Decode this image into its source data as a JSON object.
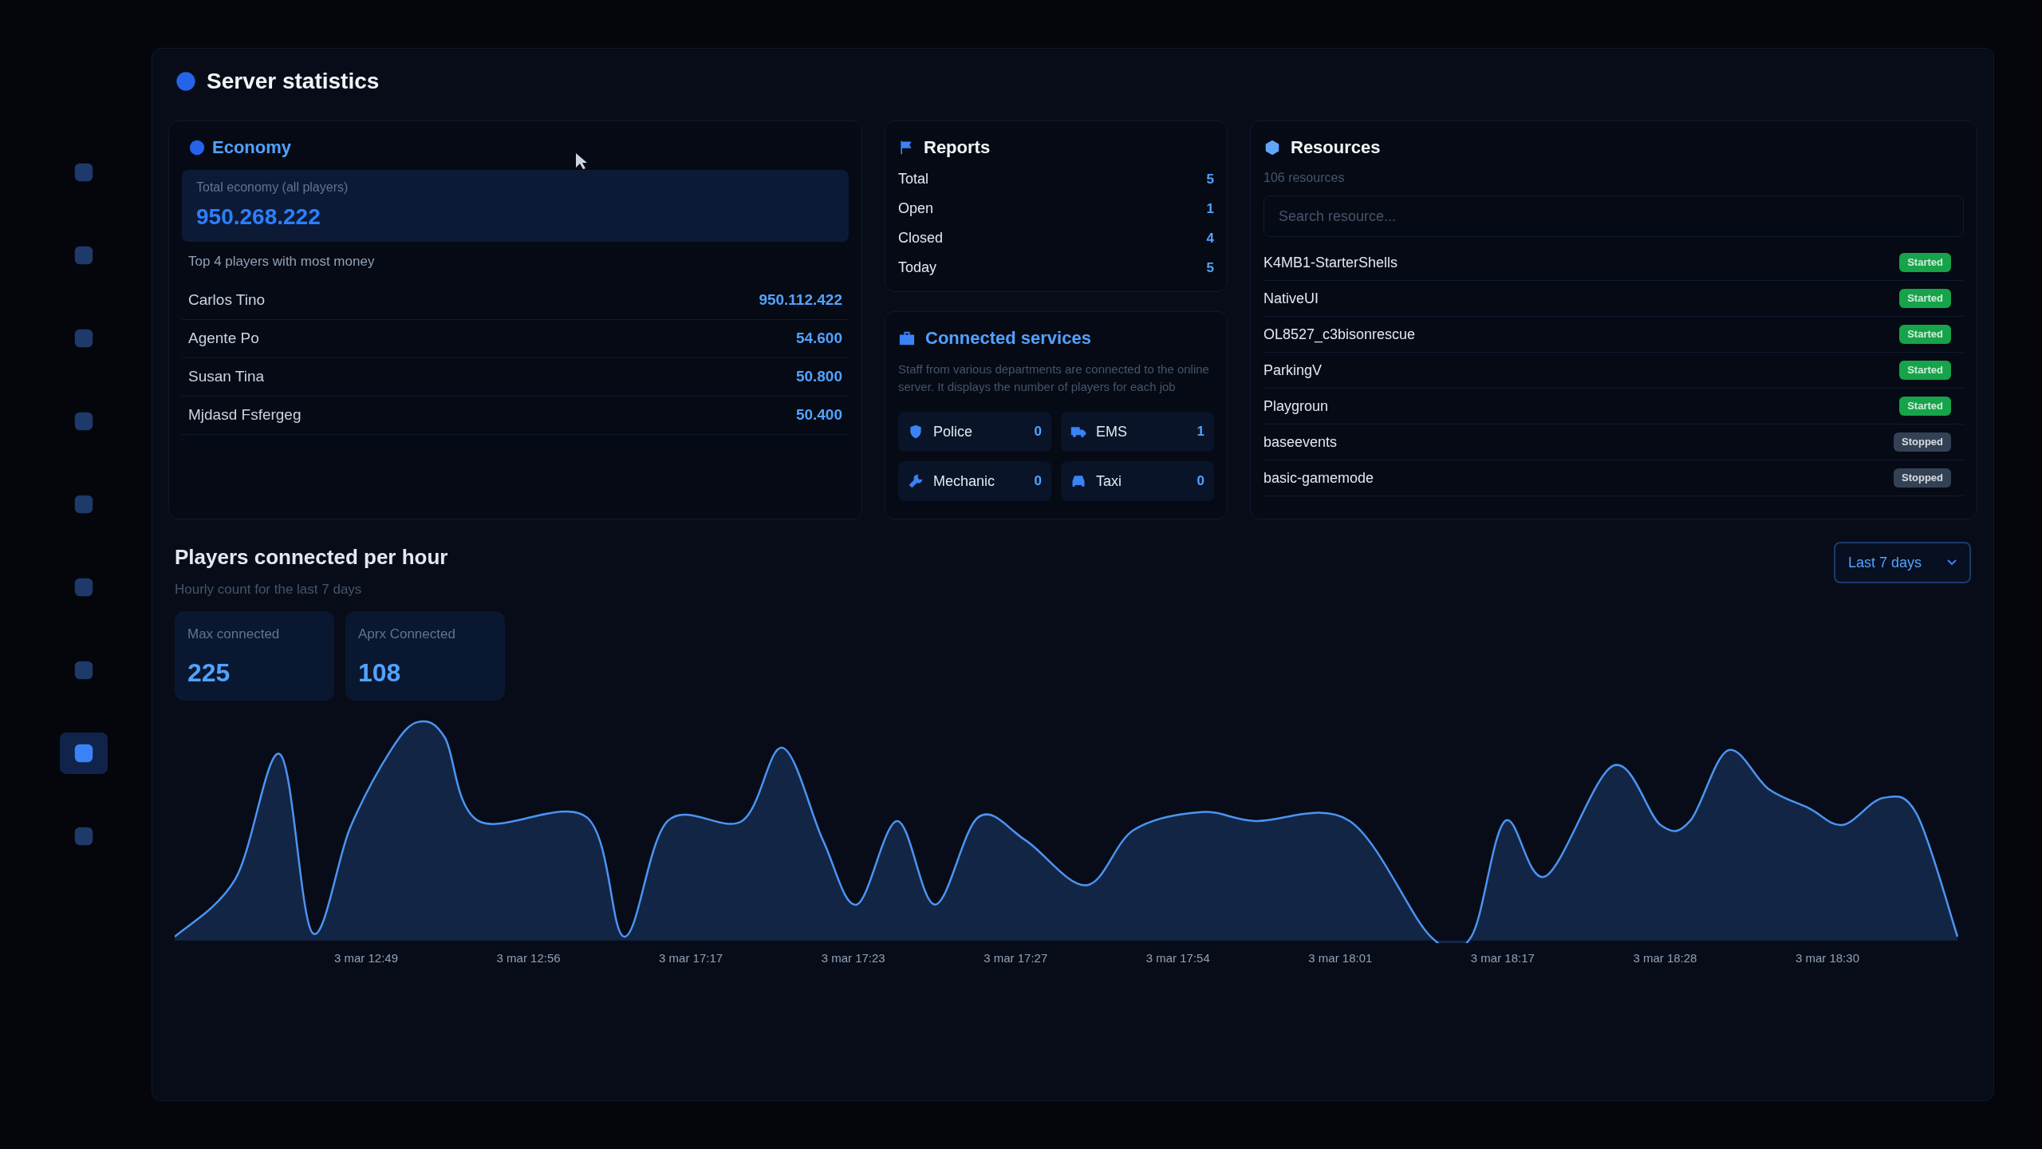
{
  "title": "Server statistics",
  "sidebar": {
    "items": [
      {
        "selected": false
      },
      {
        "selected": false
      },
      {
        "selected": false
      },
      {
        "selected": false
      },
      {
        "selected": false
      },
      {
        "selected": false
      },
      {
        "selected": false
      },
      {
        "selected": true
      },
      {
        "selected": false
      }
    ]
  },
  "economy": {
    "title": "Economy",
    "total_label": "Total economy (all players)",
    "total_value": "950.268.222",
    "top_label": "Top 4 players with most money",
    "players": [
      {
        "name": "Carlos Tino",
        "money": "950.112.422"
      },
      {
        "name": "Agente Po",
        "money": "54.600"
      },
      {
        "name": "Susan Tina",
        "money": "50.800"
      },
      {
        "name": "Mjdasd Fsfergeg",
        "money": "50.400"
      }
    ]
  },
  "reports": {
    "title": "Reports",
    "rows": [
      {
        "label": "Total",
        "value": "5"
      },
      {
        "label": "Open",
        "value": "1"
      },
      {
        "label": "Closed",
        "value": "4"
      },
      {
        "label": "Today",
        "value": "5"
      }
    ]
  },
  "services": {
    "title": "Connected services",
    "description": "Staff from various departments are connected to the online server. It displays the number of players for each job",
    "items": [
      {
        "kind": "police",
        "label": "Police",
        "count": "0"
      },
      {
        "kind": "ems",
        "label": "EMS",
        "count": "1"
      },
      {
        "kind": "mechanic",
        "label": "Mechanic",
        "count": "0"
      },
      {
        "kind": "taxi",
        "label": "Taxi",
        "count": "0"
      }
    ]
  },
  "resources": {
    "title": "Resources",
    "count": "106 resources",
    "search": {
      "placeholder": "Search resource..."
    },
    "items": [
      {
        "name": "K4MB1-StarterShells",
        "status": "Started",
        "color": "#16a34a"
      },
      {
        "name": "NativeUI",
        "status": "Started",
        "color": "#16a34a"
      },
      {
        "name": "OL8527_c3bisonrescue",
        "status": "Started",
        "color": "#16a34a"
      },
      {
        "name": "ParkingV",
        "status": "Started",
        "color": "#16a34a"
      },
      {
        "name": "Playgroun",
        "status": "Started",
        "color": "#16a34a"
      },
      {
        "name": "baseevents",
        "status": "Stopped",
        "color": "#334155"
      },
      {
        "name": "basic-gamemode",
        "status": "Stopped",
        "color": "#334155"
      }
    ]
  },
  "players_chart": {
    "title": "Players connected per hour",
    "subtitle": "Hourly count for the last 7 days",
    "range": "Last 7 days",
    "stats": [
      {
        "label": "Max connected",
        "value": "225"
      },
      {
        "label": "Aprx Connected",
        "value": "108"
      }
    ],
    "x_labels": [
      "3 mar 12:49",
      "3 mar 12:56",
      "3 mar 17:17",
      "3 mar 17:23",
      "3 mar 17:27",
      "3 mar 17:54",
      "3 mar 18:01",
      "3 mar 18:17",
      "3 mar 18:28",
      "3 mar 18:30"
    ]
  }
}
